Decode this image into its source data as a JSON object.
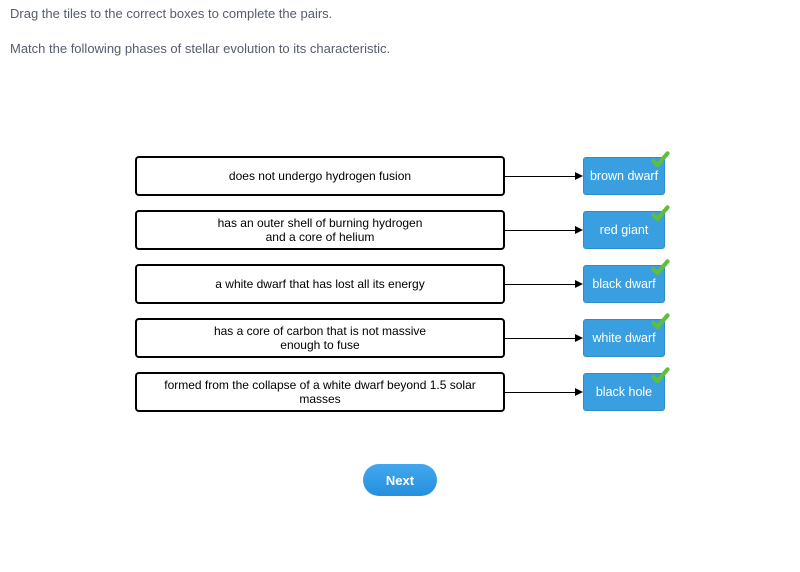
{
  "instructions": "Drag the tiles to the correct boxes to complete the pairs.",
  "question": "Match the following phases of stellar evolution to its characteristic.",
  "pairs": [
    {
      "description": "does not undergo hydrogen fusion",
      "answer": "brown dwarf"
    },
    {
      "description": "has an outer shell of burning hydrogen\nand a core of helium",
      "answer": "red giant"
    },
    {
      "description": "a white dwarf that has lost all its energy",
      "answer": "black dwarf"
    },
    {
      "description": "has a core of carbon that is not massive\nenough to fuse",
      "answer": "white dwarf"
    },
    {
      "description": "formed from the collapse of a white dwarf beyond 1.5 solar masses",
      "answer": "black hole"
    }
  ],
  "next_label": "Next"
}
